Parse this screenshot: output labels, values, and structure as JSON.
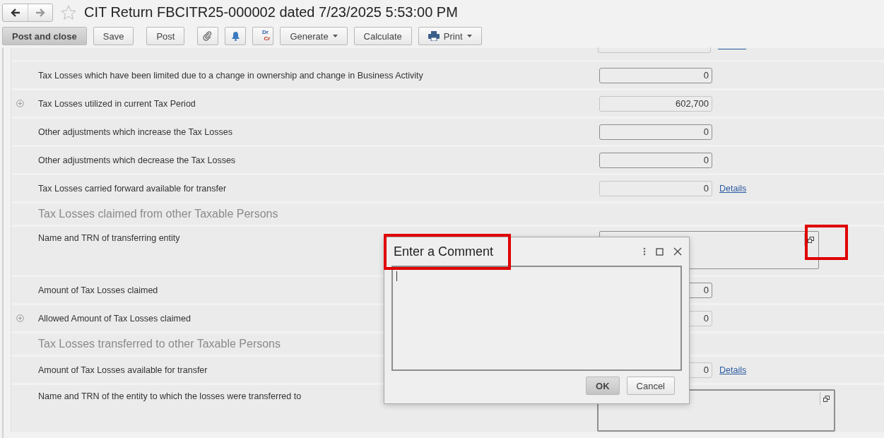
{
  "header": {
    "title": "CIT Return FBCITR25-000002 dated 7/23/2025 5:53:00 PM",
    "favorite": false
  },
  "toolbar": [
    [
      {
        "kind": "button",
        "label": "Post and close",
        "default": true
      },
      {
        "kind": "button",
        "label": "Save",
        "default": false
      }
    ],
    [
      {
        "kind": "button",
        "label": "Post",
        "default": false
      }
    ],
    [
      {
        "kind": "attach"
      },
      {
        "kind": "bell"
      },
      {
        "kind": "ledger",
        "top": "Dr",
        "bottom": "Cr"
      },
      {
        "kind": "menu",
        "label": "Generate"
      },
      {
        "kind": "button",
        "label": "Calculate",
        "default": false
      },
      {
        "kind": "print-menu",
        "label": "Print"
      }
    ]
  ],
  "rows": [
    {
      "kind": "partial"
    },
    {
      "kind": "field",
      "label": "Tax Losses which have been limited due to a change in ownership and change in Business Activity",
      "value": "0",
      "editable": true,
      "expandable": false
    },
    {
      "kind": "field",
      "label": "Tax Losses utilized in current Tax Period",
      "value": "602,700",
      "editable": false,
      "expandable": true
    },
    {
      "kind": "field",
      "label": "Other adjustments which increase the Tax Losses",
      "value": "0",
      "editable": true,
      "expandable": false
    },
    {
      "kind": "field",
      "label": "Other adjustments which decrease the Tax Losses",
      "value": "0",
      "editable": true,
      "expandable": false
    },
    {
      "kind": "field",
      "label": "Tax Losses carried forward available for transfer",
      "value": "0",
      "editable": false,
      "expandable": false,
      "link": "Details"
    },
    {
      "kind": "section",
      "title": "Tax Losses claimed from other Taxable Persons"
    },
    {
      "kind": "text-area",
      "label": "Name and TRN of transferring entity",
      "wide": false
    },
    {
      "kind": "field",
      "label": "Amount of Tax Losses claimed",
      "value": "0",
      "editable": true,
      "expandable": false
    },
    {
      "kind": "field",
      "label": "Allowed Amount of Tax Losses claimed",
      "value": "0",
      "editable": false,
      "expandable": true
    },
    {
      "kind": "section",
      "title": "Tax Losses transferred to other Taxable Persons"
    },
    {
      "kind": "field",
      "label": "Amount of Tax Losses available for transfer",
      "value": "0",
      "editable": false,
      "expandable": false,
      "link": "Details"
    },
    {
      "kind": "text-area",
      "label": "Name and TRN of the entity to which the losses were transferred to",
      "wide": true
    }
  ],
  "dialog": {
    "title": "Enter a Comment",
    "buttons": [
      {
        "label": "OK",
        "default": true
      },
      {
        "label": "Cancel",
        "default": false
      }
    ]
  }
}
